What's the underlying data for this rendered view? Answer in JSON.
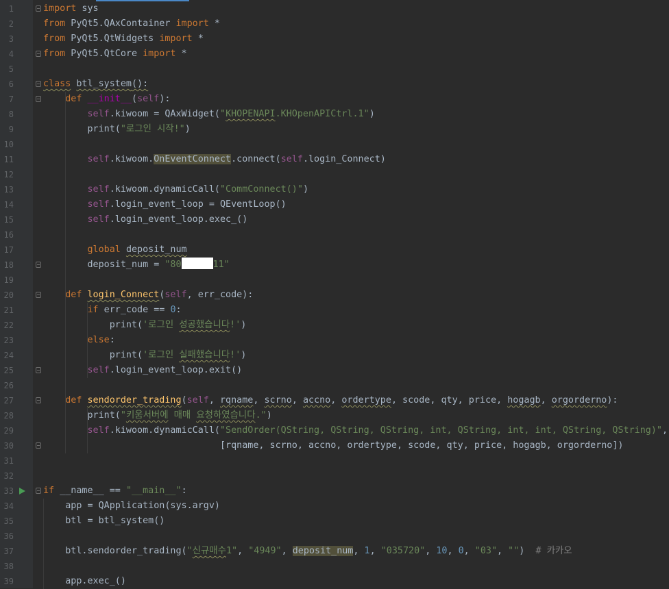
{
  "code_lines": [
    {
      "n": "1",
      "parts": [
        {
          "t": "import",
          "c": "kw"
        },
        {
          "t": " sys"
        }
      ]
    },
    {
      "n": "2",
      "parts": [
        {
          "t": "from",
          "c": "kw"
        },
        {
          "t": " PyQt5.QAxContainer "
        },
        {
          "t": "import",
          "c": "kw"
        },
        {
          "t": " *"
        }
      ]
    },
    {
      "n": "3",
      "parts": [
        {
          "t": "from",
          "c": "kw"
        },
        {
          "t": " PyQt5.QtWidgets "
        },
        {
          "t": "import",
          "c": "kw"
        },
        {
          "t": " *"
        }
      ]
    },
    {
      "n": "4",
      "parts": [
        {
          "t": "from",
          "c": "kw"
        },
        {
          "t": " PyQt5.QtCore "
        },
        {
          "t": "import",
          "c": "kw"
        },
        {
          "t": " *"
        }
      ]
    },
    {
      "n": "5",
      "parts": []
    },
    {
      "n": "6",
      "parts": [
        {
          "t": "class",
          "c": "kw wavy"
        },
        {
          "t": " "
        },
        {
          "t": "btl_system",
          "c": "wavy"
        },
        {
          "t": "():",
          "c": "wavy"
        }
      ]
    },
    {
      "n": "7",
      "parts": [
        {
          "t": "    "
        },
        {
          "t": "def",
          "c": "kw"
        },
        {
          "t": " "
        },
        {
          "t": "__init__",
          "c": "mag"
        },
        {
          "t": "("
        },
        {
          "t": "self",
          "c": "self"
        },
        {
          "t": "):"
        }
      ]
    },
    {
      "n": "8",
      "parts": [
        {
          "t": "        "
        },
        {
          "t": "self",
          "c": "self"
        },
        {
          "t": ".kiwoom = QAxWidget("
        },
        {
          "t": "\"",
          "c": "str"
        },
        {
          "t": "KHOPENAPI",
          "c": "str wavy"
        },
        {
          "t": ".KHOpenAPICtrl.1\"",
          "c": "str"
        },
        {
          "t": ")"
        }
      ]
    },
    {
      "n": "9",
      "parts": [
        {
          "t": "        print("
        },
        {
          "t": "\"로그인 시작!\"",
          "c": "str"
        },
        {
          "t": ")"
        }
      ]
    },
    {
      "n": "10",
      "parts": []
    },
    {
      "n": "11",
      "parts": [
        {
          "t": "        "
        },
        {
          "t": "self",
          "c": "self"
        },
        {
          "t": ".kiwoom."
        },
        {
          "t": "OnEventConnect",
          "c": "hl"
        },
        {
          "t": ".connect("
        },
        {
          "t": "self",
          "c": "self"
        },
        {
          "t": ".login_Connect)"
        }
      ]
    },
    {
      "n": "12",
      "parts": []
    },
    {
      "n": "13",
      "parts": [
        {
          "t": "        "
        },
        {
          "t": "self",
          "c": "self"
        },
        {
          "t": ".kiwoom.dynamicCall("
        },
        {
          "t": "\"CommConnect()\"",
          "c": "str"
        },
        {
          "t": ")"
        }
      ]
    },
    {
      "n": "14",
      "parts": [
        {
          "t": "        "
        },
        {
          "t": "self",
          "c": "self"
        },
        {
          "t": ".login_event_loop = QEventLoop()"
        }
      ]
    },
    {
      "n": "15",
      "parts": [
        {
          "t": "        "
        },
        {
          "t": "self",
          "c": "self"
        },
        {
          "t": ".login_event_loop.exec_()"
        }
      ]
    },
    {
      "n": "16",
      "parts": []
    },
    {
      "n": "17",
      "parts": [
        {
          "t": "        "
        },
        {
          "t": "global",
          "c": "kw"
        },
        {
          "t": " "
        },
        {
          "t": "deposit_num",
          "c": "wavy"
        }
      ]
    },
    {
      "n": "18",
      "parts": [
        {
          "t": "        deposit_num = "
        },
        {
          "t": "\"80",
          "c": "str"
        },
        {
          "redact": true
        },
        {
          "t": "11\"",
          "c": "str"
        }
      ]
    },
    {
      "n": "19",
      "parts": []
    },
    {
      "n": "20",
      "parts": [
        {
          "t": "    "
        },
        {
          "t": "def",
          "c": "kw"
        },
        {
          "t": " "
        },
        {
          "t": "login_Connect",
          "c": "fn wavy"
        },
        {
          "t": "("
        },
        {
          "t": "self",
          "c": "self"
        },
        {
          "t": ", err_code):"
        }
      ]
    },
    {
      "n": "21",
      "parts": [
        {
          "t": "        "
        },
        {
          "t": "if",
          "c": "kw"
        },
        {
          "t": " err_code == "
        },
        {
          "t": "0",
          "c": "num"
        },
        {
          "t": ":"
        }
      ]
    },
    {
      "n": "22",
      "parts": [
        {
          "t": "            print("
        },
        {
          "t": "'로그인 ",
          "c": "str"
        },
        {
          "t": "성공했습니다",
          "c": "str wavy"
        },
        {
          "t": "!'",
          "c": "str"
        },
        {
          "t": ")"
        }
      ]
    },
    {
      "n": "23",
      "parts": [
        {
          "t": "        "
        },
        {
          "t": "else",
          "c": "kw"
        },
        {
          "t": ":"
        }
      ]
    },
    {
      "n": "24",
      "parts": [
        {
          "t": "            print("
        },
        {
          "t": "'로그인 ",
          "c": "str"
        },
        {
          "t": "실패했습니다",
          "c": "str wavy"
        },
        {
          "t": "!'",
          "c": "str"
        },
        {
          "t": ")"
        }
      ]
    },
    {
      "n": "25",
      "parts": [
        {
          "t": "        "
        },
        {
          "t": "self",
          "c": "self"
        },
        {
          "t": ".login_event_loop.exit()"
        }
      ]
    },
    {
      "n": "26",
      "parts": []
    },
    {
      "n": "27",
      "parts": [
        {
          "t": "    "
        },
        {
          "t": "def",
          "c": "kw"
        },
        {
          "t": " "
        },
        {
          "t": "sendorder_trading",
          "c": "fn wavy"
        },
        {
          "t": "("
        },
        {
          "t": "self",
          "c": "self"
        },
        {
          "t": ", "
        },
        {
          "t": "rqname",
          "c": "wavy"
        },
        {
          "t": ", "
        },
        {
          "t": "scrno",
          "c": "wavy"
        },
        {
          "t": ", "
        },
        {
          "t": "accno",
          "c": "wavy"
        },
        {
          "t": ", "
        },
        {
          "t": "ordertype",
          "c": "wavy"
        },
        {
          "t": ", scode, qty, price, "
        },
        {
          "t": "hogagb",
          "c": "wavy"
        },
        {
          "t": ", "
        },
        {
          "t": "orgorderno",
          "c": "wavy"
        },
        {
          "t": "):"
        }
      ]
    },
    {
      "n": "28",
      "parts": [
        {
          "t": "        print("
        },
        {
          "t": "\"",
          "c": "str"
        },
        {
          "t": "키움서버에",
          "c": "str wavy"
        },
        {
          "t": " 매매 ",
          "c": "str"
        },
        {
          "t": "요청하였습니다",
          "c": "str wavy"
        },
        {
          "t": ".\"",
          "c": "str"
        },
        {
          "t": ")"
        }
      ]
    },
    {
      "n": "29",
      "parts": [
        {
          "t": "        "
        },
        {
          "t": "self",
          "c": "self"
        },
        {
          "t": ".kiwoom.dynamicCall("
        },
        {
          "t": "\"SendOrder(QString, QString, QString, int, QString, int, int, QString, QString)\"",
          "c": "str"
        },
        {
          "t": ","
        }
      ]
    },
    {
      "n": "30",
      "parts": [
        {
          "t": "                                [rqname, scrno, accno, ordertype, scode, qty, price, hogagb, orgorderno])"
        }
      ]
    },
    {
      "n": "31",
      "parts": []
    },
    {
      "n": "32",
      "parts": []
    },
    {
      "n": "33",
      "parts": [
        {
          "t": "if",
          "c": "kw"
        },
        {
          "t": " __name__ == "
        },
        {
          "t": "\"__main__\"",
          "c": "str"
        },
        {
          "t": ":"
        }
      ]
    },
    {
      "n": "34",
      "parts": [
        {
          "t": "    app = QApplication(sys.argv)"
        }
      ]
    },
    {
      "n": "35",
      "parts": [
        {
          "t": "    btl = btl_system()"
        }
      ]
    },
    {
      "n": "36",
      "parts": []
    },
    {
      "n": "37",
      "parts": [
        {
          "t": "    btl.sendorder_trading("
        },
        {
          "t": "\"",
          "c": "str"
        },
        {
          "t": "신규매수",
          "c": "str wavy"
        },
        {
          "t": "1\"",
          "c": "str"
        },
        {
          "t": ", "
        },
        {
          "t": "\"4949\"",
          "c": "str"
        },
        {
          "t": ", "
        },
        {
          "t": "deposit_num",
          "c": "hl"
        },
        {
          "t": ", "
        },
        {
          "t": "1",
          "c": "num"
        },
        {
          "t": ", "
        },
        {
          "t": "\"035720\"",
          "c": "str"
        },
        {
          "t": ", "
        },
        {
          "t": "10",
          "c": "num"
        },
        {
          "t": ", "
        },
        {
          "t": "0",
          "c": "num"
        },
        {
          "t": ", "
        },
        {
          "t": "\"03\"",
          "c": "str"
        },
        {
          "t": ", "
        },
        {
          "t": "\"\"",
          "c": "str"
        },
        {
          "t": ")  "
        },
        {
          "t": "# 카카오",
          "c": "cmt"
        }
      ]
    },
    {
      "n": "38",
      "parts": []
    },
    {
      "n": "39",
      "parts": [
        {
          "t": "    app.exec_()"
        }
      ]
    }
  ],
  "folds": [
    "1",
    "4",
    "6",
    "7",
    "18",
    "20",
    "25",
    "27",
    "30",
    "33"
  ],
  "run_lines": [
    "33"
  ],
  "colors": {
    "background": "#2b2b2b",
    "gutter": "#313335",
    "keyword": "#cc7832",
    "string": "#6a8759",
    "number": "#6897bb",
    "self": "#94558d",
    "function": "#ffc66d",
    "comment": "#808080",
    "default": "#a9b7c6"
  }
}
